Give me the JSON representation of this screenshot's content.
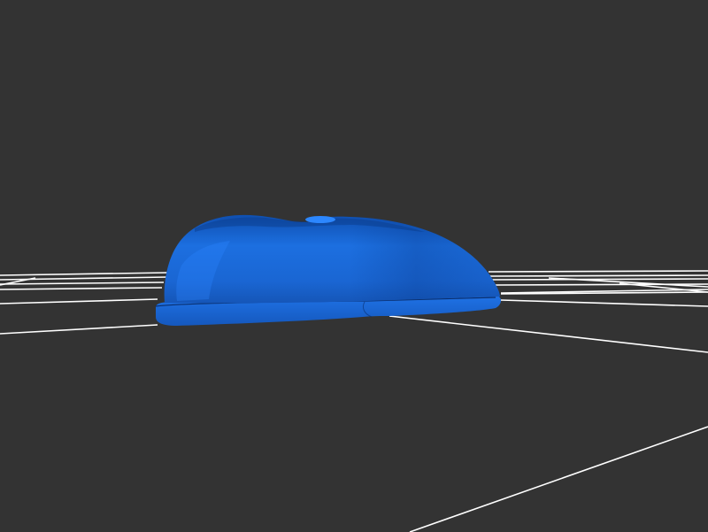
{
  "viewer": {
    "background_color": "#333333",
    "grid_color": "#ffffff",
    "model_color": "#1a6bdc"
  },
  "model": {
    "object": "shoe-shaped-solid",
    "icon": "3d-model-icon"
  }
}
